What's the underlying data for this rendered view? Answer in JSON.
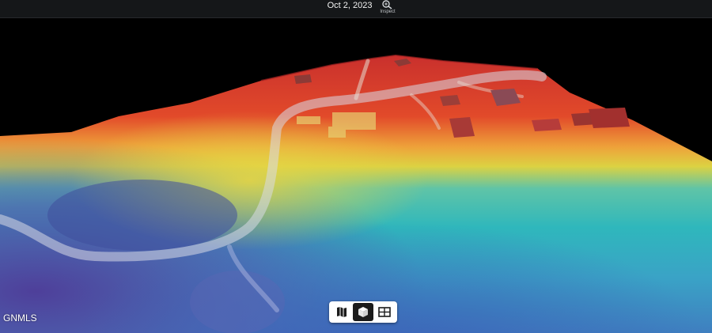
{
  "header": {
    "date": "Oct 2, 2023",
    "inspect_label": "Inspect"
  },
  "map": {
    "watermark": "GNMLS"
  },
  "view_toggle": {
    "options": [
      "map",
      "3d",
      "split"
    ],
    "selected": "3d"
  },
  "colors": {
    "accent": "#1b1b1b",
    "elevation_high": "#d8342a",
    "elevation_mid": "#e9c83a",
    "elevation_low": "#35b3b8",
    "elevation_lowest": "#4d4fa0"
  },
  "icons": {
    "inspect": "magnifier-icon",
    "map": "map-icon",
    "3d": "cube-icon",
    "split": "split-view-icon"
  }
}
